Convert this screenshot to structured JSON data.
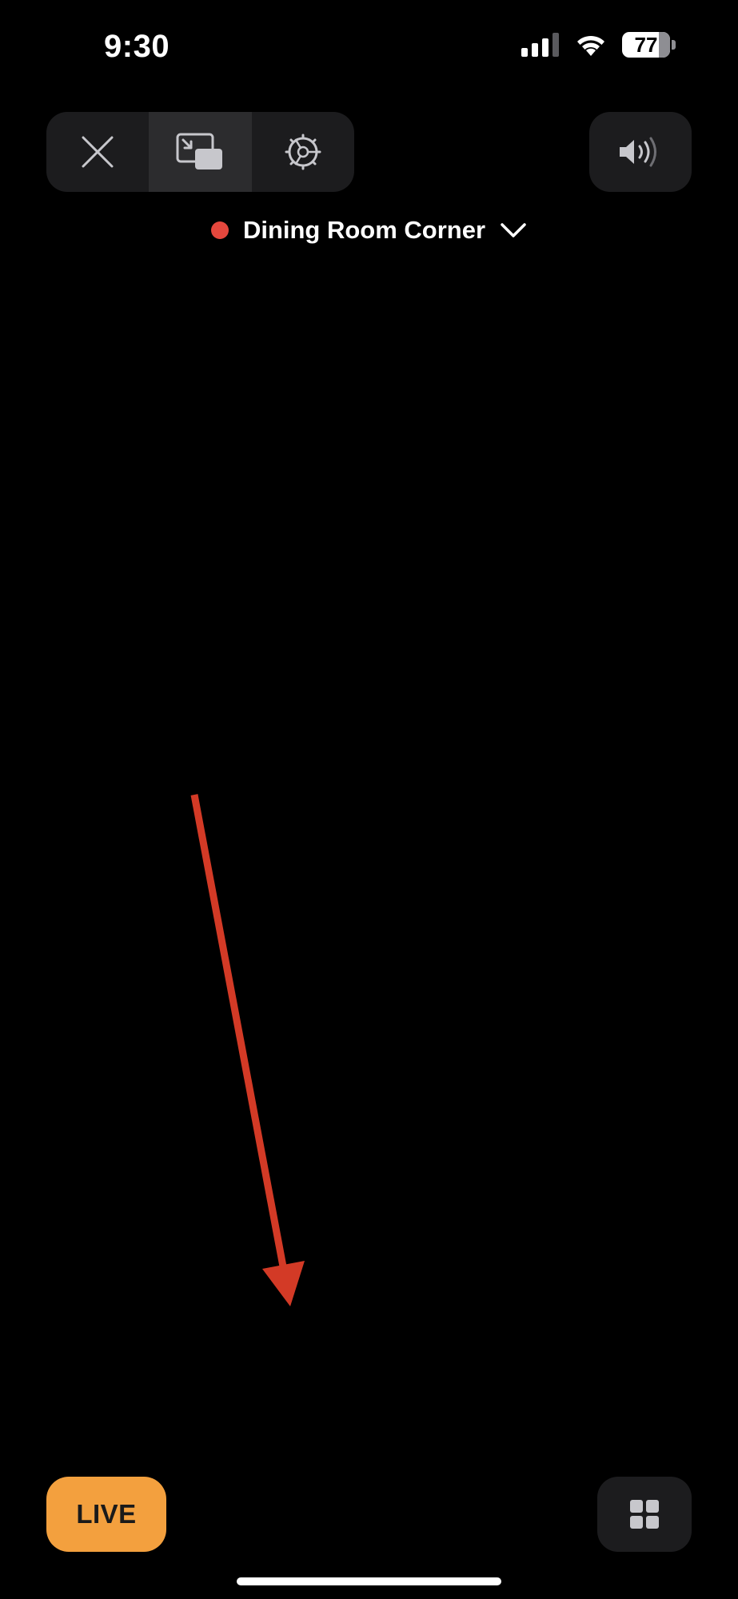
{
  "status_bar": {
    "time": "9:30",
    "battery_level": "77",
    "battery_fraction": 0.77,
    "icons": [
      "cellular-signal-icon",
      "wifi-icon",
      "battery-icon"
    ]
  },
  "toolbar": {
    "buttons": [
      {
        "icon": "close-icon",
        "active": false
      },
      {
        "icon": "picture-in-picture-icon",
        "active": true
      },
      {
        "icon": "settings-gear-icon",
        "active": false
      }
    ],
    "audio": {
      "icon": "speaker-volume-icon"
    }
  },
  "camera": {
    "name": "Dining Room Corner",
    "status_color": "#e5473d",
    "dropdown_icon": "chevron-down-icon"
  },
  "annotation": {
    "arrow_color": "#d33a26"
  },
  "bottom_bar": {
    "live_label": "LIVE",
    "live_color": "#f3a03e",
    "grid_icon": "grid-view-icon"
  }
}
